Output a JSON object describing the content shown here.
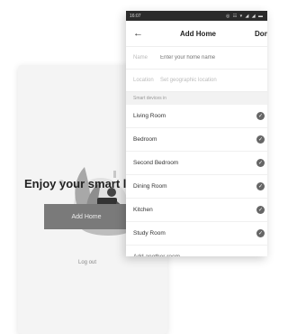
{
  "welcome": {
    "title": "Enjoy your smart l",
    "add_home_button": "Add Home",
    "logout": "Log out"
  },
  "status_bar": {
    "time": "16:07",
    "icons": "◎ ☷ ▾ ◢ ◢ ▬"
  },
  "nav": {
    "back_icon": "←",
    "title": "Add Home",
    "done": "Don"
  },
  "form": {
    "name_label": "Name",
    "name_placeholder": "Enter your home name",
    "location_label": "Location",
    "location_placeholder": "Set geographic location"
  },
  "rooms": {
    "section_title": "Smart devices in",
    "items": [
      {
        "label": "Living Room",
        "checked": true
      },
      {
        "label": "Bedroom",
        "checked": true
      },
      {
        "label": "Second Bedroom",
        "checked": true
      },
      {
        "label": "Dining Room",
        "checked": true
      },
      {
        "label": "Kitchen",
        "checked": true
      },
      {
        "label": "Study Room",
        "checked": true
      }
    ],
    "add_another": "Add another room"
  },
  "colors": {
    "button_gray": "#7a7a7a",
    "check_gray": "#666666"
  }
}
